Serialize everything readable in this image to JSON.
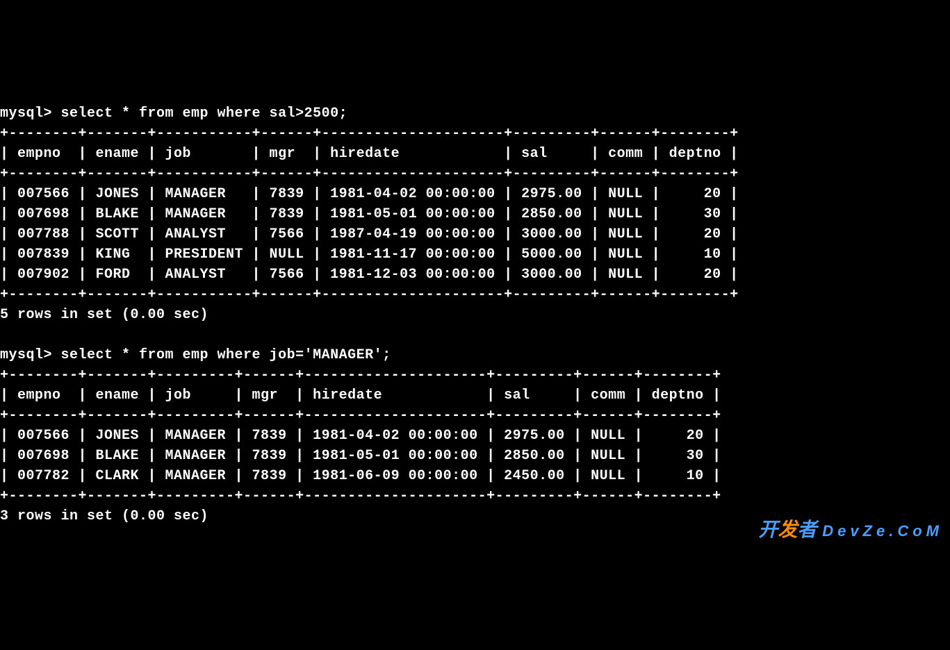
{
  "prompt": "mysql>",
  "query1": {
    "command": "select * from emp where sal>2500;",
    "columns": [
      "empno",
      "ename",
      "job",
      "mgr",
      "hiredate",
      "sal",
      "comm",
      "deptno"
    ],
    "rows": [
      {
        "empno": "007566",
        "ename": "JONES",
        "job": "MANAGER",
        "mgr": "7839",
        "hiredate": "1981-04-02 00:00:00",
        "sal": "2975.00",
        "comm": "NULL",
        "deptno": "20"
      },
      {
        "empno": "007698",
        "ename": "BLAKE",
        "job": "MANAGER",
        "mgr": "7839",
        "hiredate": "1981-05-01 00:00:00",
        "sal": "2850.00",
        "comm": "NULL",
        "deptno": "30"
      },
      {
        "empno": "007788",
        "ename": "SCOTT",
        "job": "ANALYST",
        "mgr": "7566",
        "hiredate": "1987-04-19 00:00:00",
        "sal": "3000.00",
        "comm": "NULL",
        "deptno": "20"
      },
      {
        "empno": "007839",
        "ename": "KING",
        "job": "PRESIDENT",
        "mgr": "NULL",
        "hiredate": "1981-11-17 00:00:00",
        "sal": "5000.00",
        "comm": "NULL",
        "deptno": "10"
      },
      {
        "empno": "007902",
        "ename": "FORD",
        "job": "ANALYST",
        "mgr": "7566",
        "hiredate": "1981-12-03 00:00:00",
        "sal": "3000.00",
        "comm": "NULL",
        "deptno": "20"
      }
    ],
    "footer": "5 rows in set (0.00 sec)"
  },
  "query2": {
    "command": "select * from emp where job='MANAGER';",
    "columns": [
      "empno",
      "ename",
      "job",
      "mgr",
      "hiredate",
      "sal",
      "comm",
      "deptno"
    ],
    "rows": [
      {
        "empno": "007566",
        "ename": "JONES",
        "job": "MANAGER",
        "mgr": "7839",
        "hiredate": "1981-04-02 00:00:00",
        "sal": "2975.00",
        "comm": "NULL",
        "deptno": "20"
      },
      {
        "empno": "007698",
        "ename": "BLAKE",
        "job": "MANAGER",
        "mgr": "7839",
        "hiredate": "1981-05-01 00:00:00",
        "sal": "2850.00",
        "comm": "NULL",
        "deptno": "30"
      },
      {
        "empno": "007782",
        "ename": "CLARK",
        "job": "MANAGER",
        "mgr": "7839",
        "hiredate": "1981-06-09 00:00:00",
        "sal": "2450.00",
        "comm": "NULL",
        "deptno": "10"
      }
    ],
    "footer": "3 rows in set (0.00 sec)"
  },
  "watermark": {
    "line1a": "开",
    "line1b": "发",
    "line1c": "者",
    "line2": "DevZe.CoM"
  },
  "sep1": "+--------+-------+-----------+------+---------------------+---------+------+--------+",
  "hdr1": "| empno  | ename | job       | mgr  | hiredate            | sal     | comm | deptno |",
  "r1_0": "| 007566 | JONES | MANAGER   | 7839 | 1981-04-02 00:00:00 | 2975.00 | NULL |     20 |",
  "r1_1": "| 007698 | BLAKE | MANAGER   | 7839 | 1981-05-01 00:00:00 | 2850.00 | NULL |     30 |",
  "r1_2": "| 007788 | SCOTT | ANALYST   | 7566 | 1987-04-19 00:00:00 | 3000.00 | NULL |     20 |",
  "r1_3": "| 007839 | KING  | PRESIDENT | NULL | 1981-11-17 00:00:00 | 5000.00 | NULL |     10 |",
  "r1_4": "| 007902 | FORD  | ANALYST   | 7566 | 1981-12-03 00:00:00 | 3000.00 | NULL |     20 |",
  "sep2": "+--------+-------+---------+------+---------------------+---------+------+--------+",
  "hdr2": "| empno  | ename | job     | mgr  | hiredate            | sal     | comm | deptno |",
  "r2_0": "| 007566 | JONES | MANAGER | 7839 | 1981-04-02 00:00:00 | 2975.00 | NULL |     20 |",
  "r2_1": "| 007698 | BLAKE | MANAGER | 7839 | 1981-05-01 00:00:00 | 2850.00 | NULL |     30 |",
  "r2_2": "| 007782 | CLARK | MANAGER | 7839 | 1981-06-09 00:00:00 | 2450.00 | NULL |     10 |",
  "cmd1_line": "mysql> select * from emp where sal>2500;",
  "cmd2_line": "mysql> select * from emp where job='MANAGER';"
}
